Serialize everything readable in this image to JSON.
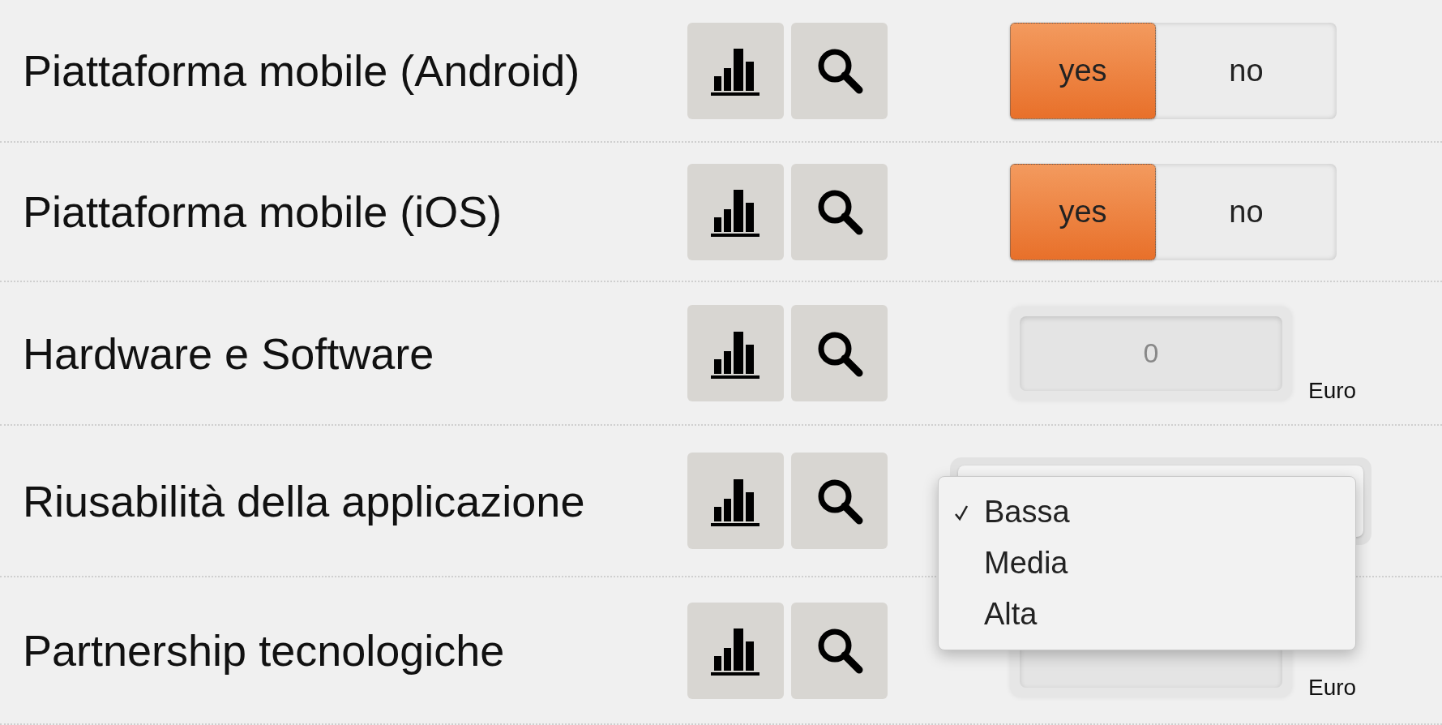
{
  "rows": [
    {
      "label": "Piattaforma mobile (Android)",
      "control": {
        "kind": "toggle",
        "options": [
          {
            "label": "yes",
            "selected": true
          },
          {
            "label": "no",
            "selected": false
          }
        ]
      }
    },
    {
      "label": "Piattaforma mobile (iOS)",
      "control": {
        "kind": "toggle",
        "options": [
          {
            "label": "yes",
            "selected": true
          },
          {
            "label": "no",
            "selected": false
          }
        ]
      }
    },
    {
      "label": "Hardware e Software",
      "control": {
        "kind": "amount",
        "value": "0",
        "unit": "Euro"
      }
    },
    {
      "label": "Riusabilità della applicazione",
      "control": {
        "kind": "select",
        "expanded": true,
        "options": [
          {
            "label": "Bassa",
            "selected": true
          },
          {
            "label": "Media",
            "selected": false
          },
          {
            "label": "Alta",
            "selected": false
          }
        ]
      }
    },
    {
      "label": "Partnership tecnologiche",
      "control": {
        "kind": "amount",
        "unit": "Euro"
      }
    }
  ]
}
